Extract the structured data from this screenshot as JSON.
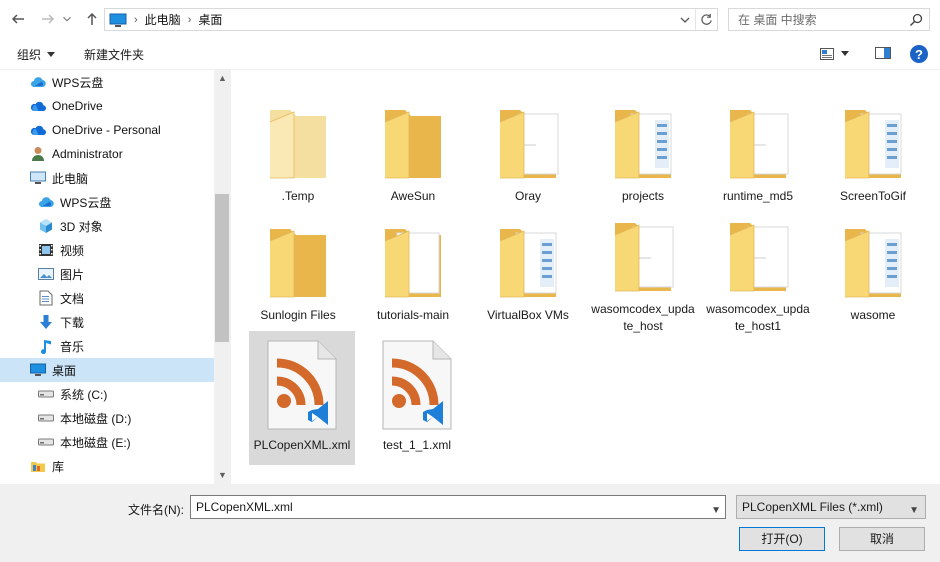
{
  "address": {
    "crumbs": [
      "此电脑",
      "桌面"
    ],
    "search_placeholder": "在 桌面 中搜索"
  },
  "toolbar": {
    "organize_label": "组织",
    "new_folder_label": "新建文件夹"
  },
  "nav": {
    "items": [
      {
        "label": "WPS云盘",
        "icon": "wps-cloud-icon"
      },
      {
        "label": "OneDrive",
        "icon": "onedrive-icon"
      },
      {
        "label": "OneDrive - Personal",
        "icon": "onedrive-icon"
      },
      {
        "label": "Administrator",
        "icon": "user-icon"
      },
      {
        "label": "此电脑",
        "icon": "this-pc-icon"
      },
      {
        "label": "WPS云盘",
        "icon": "wps-cloud-icon"
      },
      {
        "label": "3D 对象",
        "icon": "3d-objects-icon"
      },
      {
        "label": "视频",
        "icon": "videos-icon"
      },
      {
        "label": "图片",
        "icon": "pictures-icon"
      },
      {
        "label": "文档",
        "icon": "documents-icon"
      },
      {
        "label": "下载",
        "icon": "downloads-icon"
      },
      {
        "label": "音乐",
        "icon": "music-icon"
      },
      {
        "label": "桌面",
        "icon": "desktop-icon",
        "selected": true
      },
      {
        "label": "系统 (C:)",
        "icon": "drive-icon"
      },
      {
        "label": "本地磁盘 (D:)",
        "icon": "drive-icon"
      },
      {
        "label": "本地磁盘 (E:)",
        "icon": "drive-icon"
      },
      {
        "label": "库",
        "icon": "library-icon"
      }
    ]
  },
  "files": [
    {
      "name": ".Temp",
      "kind": "folder-light"
    },
    {
      "name": "AweSun",
      "kind": "folder"
    },
    {
      "name": "Oray",
      "kind": "folder-doc"
    },
    {
      "name": "projects",
      "kind": "folder-stack"
    },
    {
      "name": "runtime_md5",
      "kind": "folder-doc"
    },
    {
      "name": "ScreenToGif",
      "kind": "folder-stack"
    },
    {
      "name": "Sunlogin Files",
      "kind": "folder"
    },
    {
      "name": "tutorials-main",
      "kind": "folder-green"
    },
    {
      "name": "VirtualBox VMs",
      "kind": "folder-stack"
    },
    {
      "name": "wasomcodex_update_host",
      "kind": "folder-doc"
    },
    {
      "name": "wasomcodex_update_host1",
      "kind": "folder-doc"
    },
    {
      "name": "wasome",
      "kind": "folder-stack"
    },
    {
      "name": "PLCopenXML.xml",
      "kind": "xml",
      "selected": true
    },
    {
      "name": "test_1_1.xml",
      "kind": "xml"
    }
  ],
  "footer": {
    "filename_label": "文件名(N):",
    "filename_value": "PLCopenXML.xml",
    "filetype_value": "PLCopenXML Files (*.xml)",
    "open_label": "打开(O)",
    "cancel_label": "取消"
  },
  "colors": {
    "folder": "#f8d775",
    "folder_dark": "#e8b64a",
    "rss": "#d3692a",
    "vscode": "#1d7fd8",
    "selection": "#cce4f7"
  }
}
